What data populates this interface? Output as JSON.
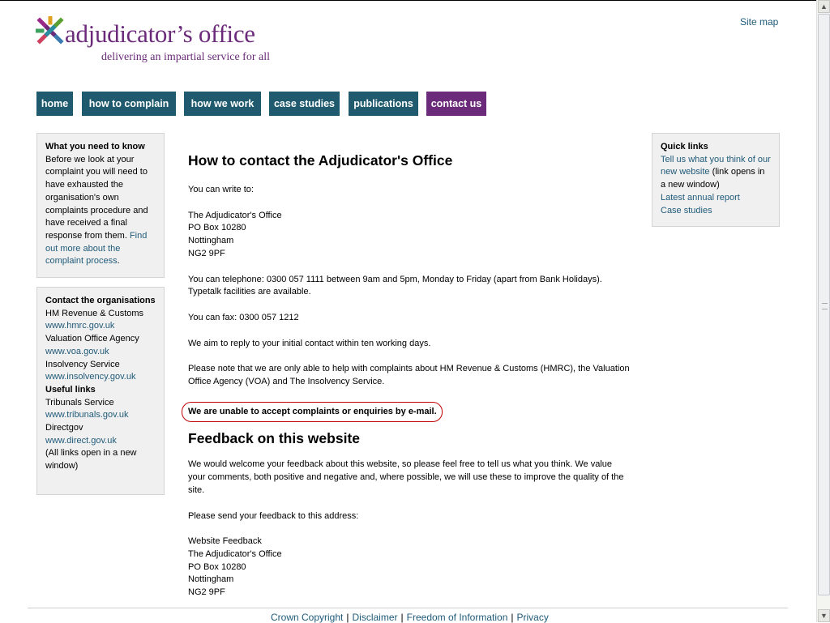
{
  "header": {
    "logo_title": "adjudicator’s office",
    "logo_tagline": "delivering an impartial service for all",
    "site_map": "Site map"
  },
  "nav": [
    "home",
    "how to complain",
    "how we work",
    "case studies",
    "publications",
    "contact us"
  ],
  "nav_active": "contact us",
  "left": {
    "what_you_need": {
      "heading": "What you need to know",
      "text": "Before we look at your complaint you will need to have exhausted the organisation's own complaints procedure and have received a final response from them.",
      "link": "Find out more about the complaint process",
      "after": "."
    },
    "contact_orgs": {
      "heading": "Contact the organisations",
      "orgs": [
        {
          "name": "HM Revenue & Customs",
          "url": "www.hmrc.gov.uk"
        },
        {
          "name": "Valuation Office Agency",
          "url": "www.voa.gov.uk"
        },
        {
          "name": "Insolvency Service",
          "url": "www.insolvency.gov.uk"
        }
      ],
      "useful_heading": "Useful links",
      "useful": [
        {
          "name": "Tribunals Service",
          "url": "www.tribunals.gov.uk"
        },
        {
          "name": "Directgov",
          "url": "www.direct.gov.uk"
        }
      ],
      "note": "(All links open in a new window)"
    }
  },
  "quick_links": {
    "heading": "Quick links",
    "link1": "Tell us what you think of our new website",
    "link1_note": " (link opens in a new window)",
    "link2": "Latest annual report",
    "link3": "Case studies"
  },
  "main": {
    "title": "How to contact the Adjudicator's Office",
    "write_intro": "You can write to:",
    "address": [
      "The Adjudicator's Office",
      "PO Box 10280",
      "Nottingham",
      "NG2 9PF"
    ],
    "telephone": "You can telephone: 0300 057 1111 between 9am and 5pm, Monday to Friday (apart from Bank Holidays). Typetalk facilities are available.",
    "fax": "You can fax: 0300 057 1212",
    "reply": "We aim to reply to your initial contact within ten working days.",
    "note": "Please note that we are only able to help with complaints about HM Revenue & Customs (HMRC), the Valuation Office Agency (VOA) and The Insolvency Service.",
    "email_notice": "We are unable to accept complaints or enquiries by e-mail.",
    "feedback_title": "Feedback on this website",
    "feedback_text": "We would welcome your feedback about this website, so please feel free to tell us what you think. We value your comments, both positive and negative and, where possible, we will use these to improve the quality of the site.",
    "feedback_send": "Please send your feedback to this address:",
    "feedback_address": [
      "Website Feedback",
      "The Adjudicator's Office",
      "PO Box 10280",
      "Nottingham",
      "NG2 9PF"
    ]
  },
  "footer": [
    "Crown Copyright",
    "Disclaimer",
    "Freedom of Information",
    "Privacy"
  ],
  "colors": {
    "purple": "#6b2b7a",
    "teal": "#1f5a6e",
    "link": "#1f5a78"
  }
}
